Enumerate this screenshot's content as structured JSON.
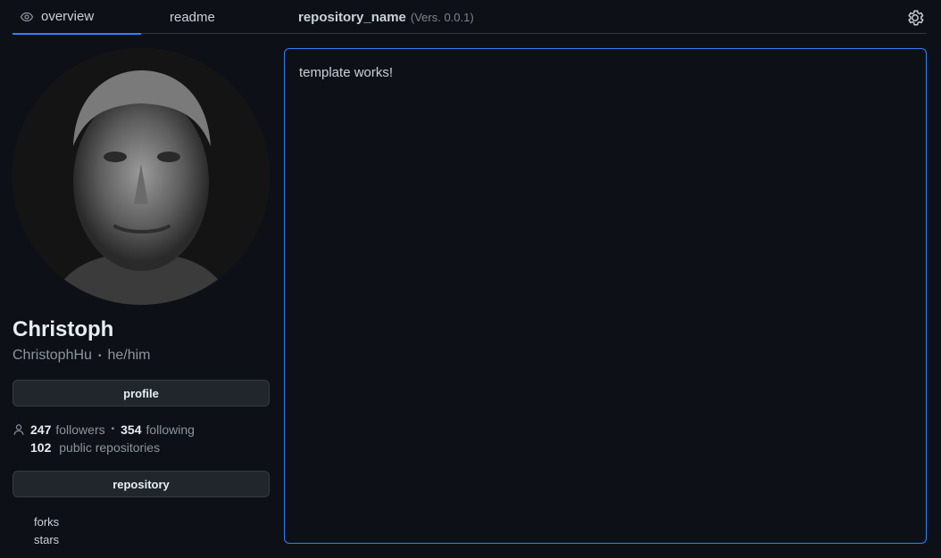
{
  "tabs": {
    "overview": "overview",
    "readme": "readme"
  },
  "repo": {
    "name": "repository_name",
    "version": "(Vers. 0.0.1)"
  },
  "profile": {
    "name": "Christoph",
    "username": "ChristophHu",
    "pronouns": "he/him",
    "profile_button": "profile",
    "followers_count": "247",
    "followers_label": "followers",
    "following_count": "354",
    "following_label": "following",
    "repos_count": "102",
    "repos_label": "public repositories",
    "repository_button": "repository",
    "links": [
      "forks",
      "stars"
    ]
  },
  "content": {
    "text": "template works!"
  },
  "colors": {
    "background": "#0d1117",
    "accent": "#2f81f7",
    "button_bg": "#21262d"
  },
  "icons": [
    "eye-icon",
    "gear-icon",
    "person-icon"
  ]
}
